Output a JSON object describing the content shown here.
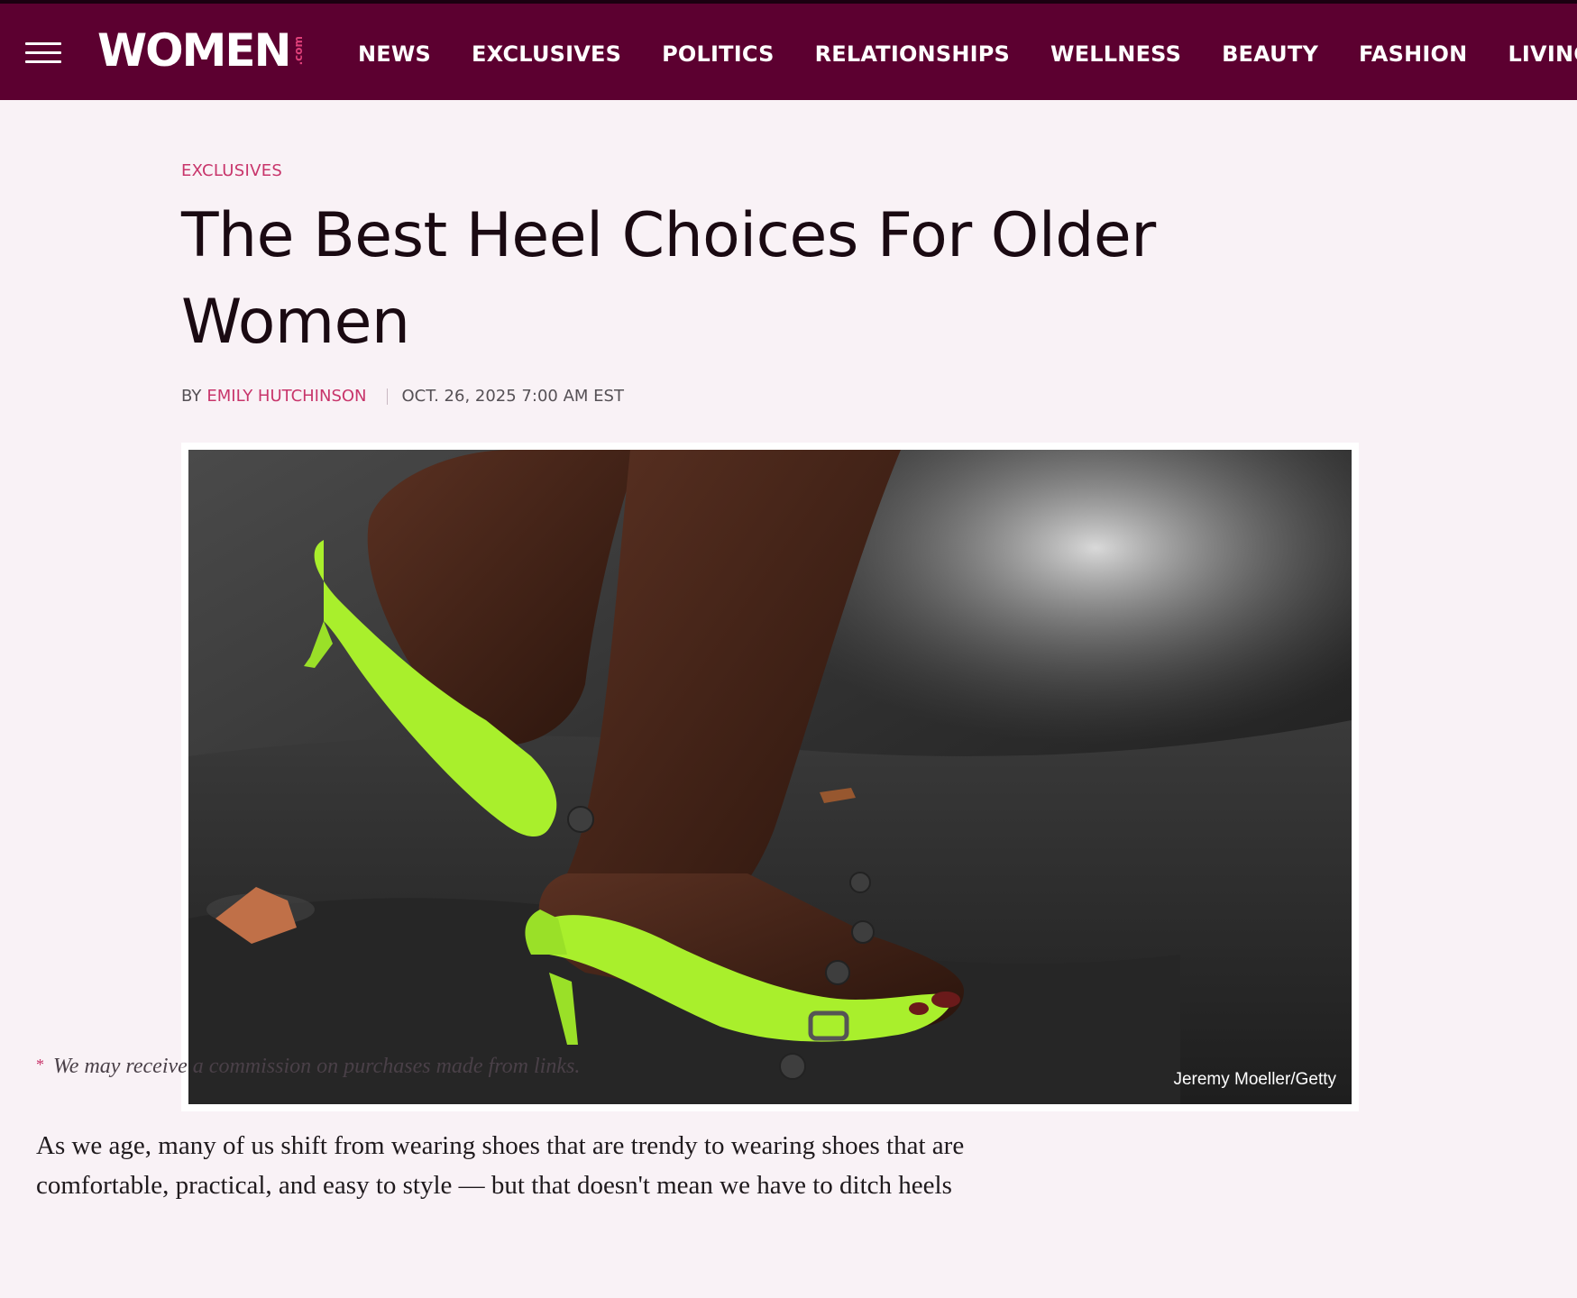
{
  "header": {
    "logo_text": "WOMEN",
    "logo_suffix": ".com",
    "nav": [
      {
        "label": "NEWS"
      },
      {
        "label": "EXCLUSIVES"
      },
      {
        "label": "POLITICS"
      },
      {
        "label": "RELATIONSHIPS"
      },
      {
        "label": "WELLNESS"
      },
      {
        "label": "BEAUTY"
      },
      {
        "label": "FASHION"
      },
      {
        "label": "LIVING"
      }
    ]
  },
  "article": {
    "category": "EXCLUSIVES",
    "title": "The Best Heel Choices For Older Women",
    "byline_prefix": "BY",
    "author": "EMILY HUTCHINSON",
    "date": "OCT. 26, 2025 7:00 AM EST",
    "image_credit": "Jeremy Moeller/Getty",
    "disclaimer_marker": "*",
    "disclaimer": "We may receive a commission on purchases made from links.",
    "body_intro": "As we age, many of us shift from wearing shoes that are trendy to wearing shoes that are comfortable, practical, and easy to style — but that doesn't mean we have to ditch heels"
  },
  "colors": {
    "header_bg": "#5c0030",
    "accent": "#c8356b",
    "page_bg": "#f9f2f6",
    "shoe": "#a8f02a"
  }
}
